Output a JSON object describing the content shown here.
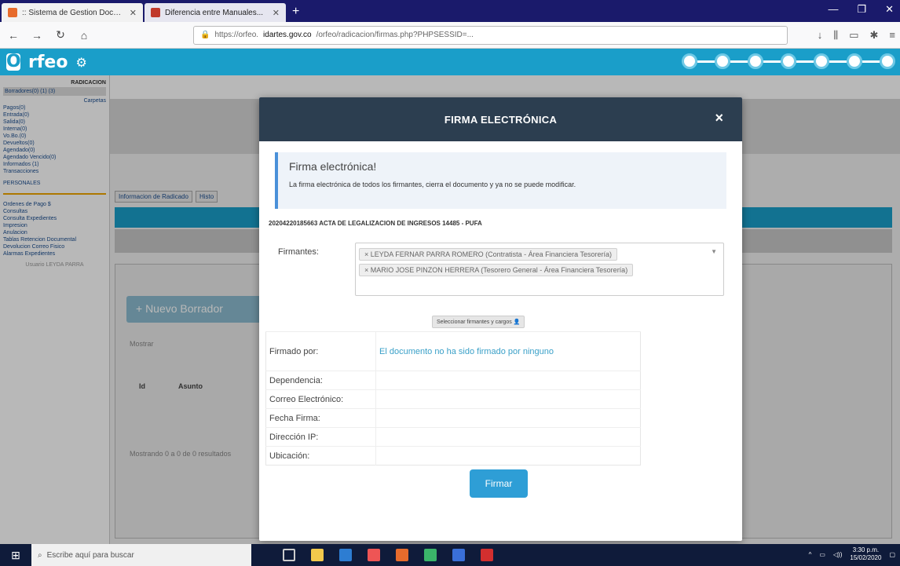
{
  "browser": {
    "tabs": [
      {
        "title": ":: Sistema de Gestion Docum...",
        "active": true
      },
      {
        "title": "Diferencia entre Manuales...",
        "active": false
      }
    ],
    "url_prefix": "https://orfeo.",
    "url_domain": "idartes.gov.co",
    "url_rest": "/orfeo/radicacion/firmas.php?PHPSESSID=..."
  },
  "app": {
    "logo_text": "rfeo"
  },
  "sidebar": {
    "header": "RADICACION",
    "items": [
      "Borradores(0) (1) (3)",
      "Carpetas",
      "Pagos(0)",
      "Entrada(0)",
      "Salida(0)",
      "Interna(0)",
      "Vo.Bo.(0)",
      "Devueltos(0)",
      "Agendado(0)",
      "Agendado Vencido(0)",
      "Informados (1)",
      "Transacciones",
      "PERSONALES"
    ],
    "items2": [
      "Ordenes de Pago $",
      "Consultas",
      "Consulta Expedientes",
      "Impresion",
      "Anulacion",
      "Tablas Retencion Documental",
      "Devolucion Correo Fisico",
      "Alarmas Expedientes"
    ],
    "footer": "Usuario LEYDA PARRA"
  },
  "background": {
    "tab1": "Informacion de Radicado",
    "tab2": "Histo",
    "new_draft": "+ Nuevo Borrador",
    "mostrar": "Mostrar",
    "id_col": "Id",
    "asunto_col": "Asunto",
    "showing": "Mostrando 0 a 0 de 0 resultados"
  },
  "modal": {
    "title": "FIRMA ELECTRÓNICA",
    "close": "×",
    "info_title": "Firma electrónica!",
    "info_text": "La firma electrónica de todos los firmantes, cierra el documento y ya no se puede modificar.",
    "document": "20204220185663 ACTA DE LEGALIZACION DE INGRESOS 14485 - PUFA",
    "firmantes_label": "Firmantes:",
    "firmantes": [
      "× LEYDA FERNAR PARRA ROMERO (Contratista - Área Financiera Tesorería)",
      "× MARIO JOSE PINZON HERRERA (Tesorero General - Área Financiera Tesorería)"
    ],
    "select_button": "Seleccionar firmantes y cargos",
    "rows": [
      {
        "label": "Firmado por:",
        "value": "El documento no ha sido firmado por ninguno"
      },
      {
        "label": "Dependencia:",
        "value": ""
      },
      {
        "label": "Correo Electrónico:",
        "value": ""
      },
      {
        "label": "Fecha Firma:",
        "value": ""
      },
      {
        "label": "Dirección IP:",
        "value": ""
      },
      {
        "label": "Ubicación:",
        "value": ""
      }
    ],
    "firmar": "Firmar"
  },
  "taskbar": {
    "search_placeholder": "Escribe aquí para buscar",
    "time": "3:30 p.m.",
    "date": "15/02/2020"
  }
}
